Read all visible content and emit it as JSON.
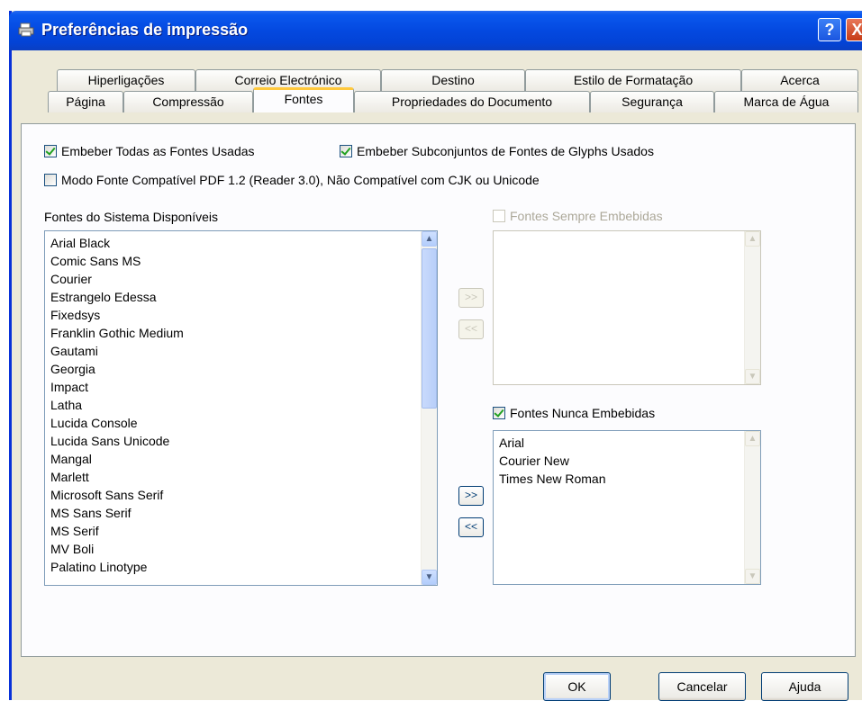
{
  "window": {
    "title": "Preferências de impressão",
    "help_label": "?",
    "close_label": "X"
  },
  "tabs_row1": [
    "Hiperligações",
    "Correio Electrónico",
    "Destino",
    "Estilo de Formatação",
    "Acerca"
  ],
  "tabs_row2": [
    "Página",
    "Compressão",
    "Fontes",
    "Propriedades do Documento",
    "Segurança",
    "Marca de Água"
  ],
  "active_tab": "Fontes",
  "options": {
    "embed_all": "Embeber Todas as Fontes Usadas",
    "embed_subsets": "Embeber Subconjuntos de Fontes de Glyphs Usados",
    "pdf12_mode": "Modo Fonte Compatível PDF 1.2 (Reader 3.0), Não Compatível com CJK ou Unicode"
  },
  "available_fonts": {
    "label": "Fontes do Sistema Disponíveis",
    "items": [
      "Arial Black",
      "Comic Sans MS",
      "Courier",
      "Estrangelo Edessa",
      "Fixedsys",
      "Franklin Gothic Medium",
      "Gautami",
      "Georgia",
      "Impact",
      "Latha",
      "Lucida Console",
      "Lucida Sans Unicode",
      "Mangal",
      "Marlett",
      "Microsoft Sans Serif",
      "MS Sans Serif",
      "MS Serif",
      "MV Boli",
      "Palatino Linotype"
    ]
  },
  "always_embedded": {
    "label": "Fontes Sempre Embebidas",
    "items": []
  },
  "never_embedded": {
    "label": "Fontes Nunca Embebidas",
    "items": [
      "Arial",
      "Courier New",
      "Times New Roman"
    ]
  },
  "move_buttons": {
    "add": ">>",
    "remove": "<<"
  },
  "buttons": {
    "ok": "OK",
    "cancel": "Cancelar",
    "help": "Ajuda"
  }
}
